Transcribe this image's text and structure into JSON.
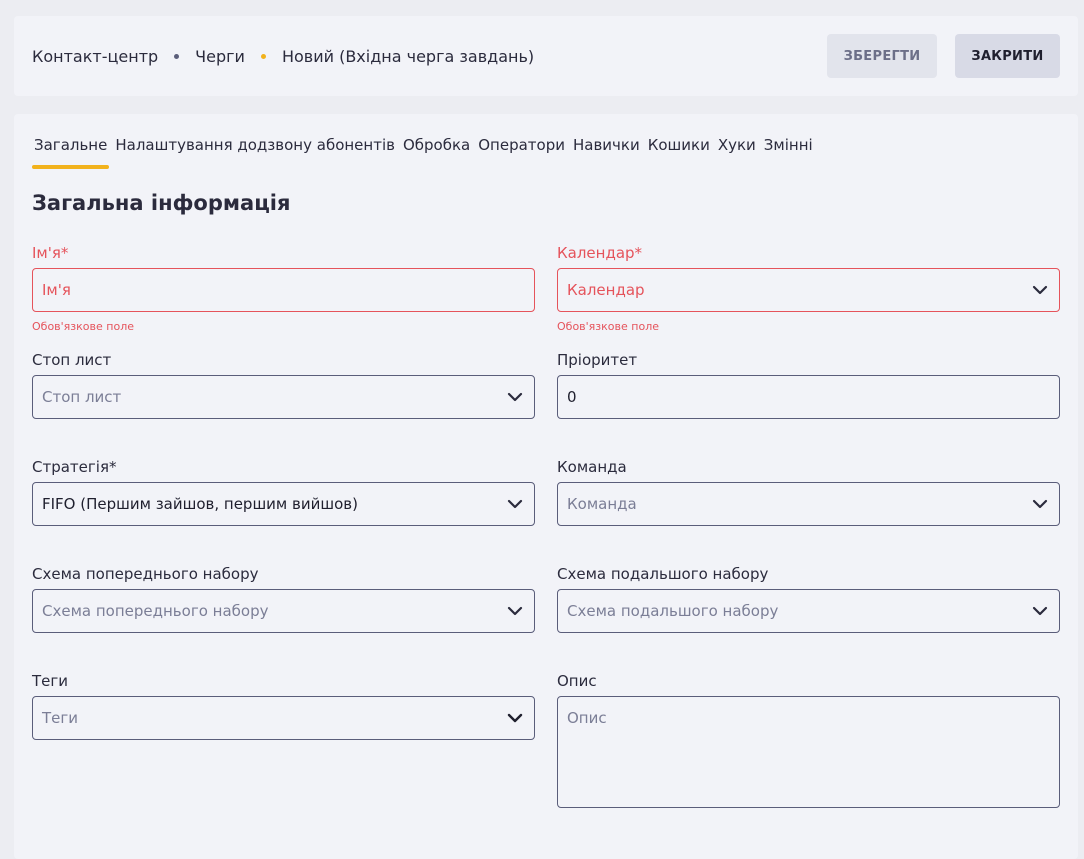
{
  "breadcrumb": [
    "Контакт-центр",
    "Черги",
    "Новий (Вхідна черга завдань)"
  ],
  "buttons": {
    "save": "ЗБЕРЕГТИ",
    "close": "ЗАКРИТИ"
  },
  "tabs": [
    "Загальне",
    "Налаштування додзвону абонентів",
    "Обробка",
    "Оператори",
    "Навички",
    "Кошики",
    "Хуки",
    "Змінні"
  ],
  "section_title": "Загальна інформація",
  "fields": {
    "name": {
      "label": "Ім'я*",
      "placeholder": "Ім'я",
      "error": "Обов'язкове поле"
    },
    "calendar": {
      "label": "Календар*",
      "placeholder": "Календар",
      "error": "Обов'язкове поле"
    },
    "stoplist": {
      "label": "Стоп лист",
      "placeholder": "Стоп лист"
    },
    "priority": {
      "label": "Пріоритет",
      "value": "0"
    },
    "strategy": {
      "label": "Стратегія*",
      "value": "FIFO (Першим зайшов, першим вийшов)"
    },
    "team": {
      "label": "Команда",
      "placeholder": "Команда"
    },
    "pre_schema": {
      "label": "Схема попереднього набору",
      "placeholder": "Схема попереднього набору"
    },
    "post_schema": {
      "label": "Схема подальшого набору",
      "placeholder": "Схема подальшого набору"
    },
    "tags": {
      "label": "Теги",
      "placeholder": "Теги"
    },
    "description": {
      "label": "Опис",
      "placeholder": "Опис"
    }
  },
  "colors": {
    "accent": "#f2b21c",
    "error": "#e5535b",
    "border": "#5a5d7a"
  },
  "icons": {
    "chevron": "chevron-down-icon"
  }
}
